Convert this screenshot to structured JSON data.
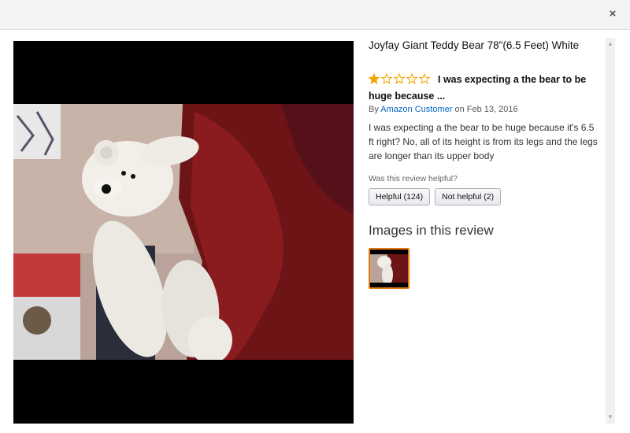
{
  "window": {
    "close_label": "×"
  },
  "product": {
    "title": "Joyfay Giant Teddy Bear 78\"(6.5 Feet) White"
  },
  "review": {
    "rating": 1,
    "rating_max": 5,
    "headline": "I was expecting a the bear to be huge because ...",
    "by_prefix": "By",
    "author": "Amazon Customer",
    "date_prefix": "on",
    "date": "Feb 13, 2016",
    "body": "I was expecting a the bear to be huge because it's 6.5 ft right? No, all of its height is from its legs and the legs are longer than its upper body",
    "helpful_question": "Was this review helpful?",
    "helpful_button": "Helpful (124)",
    "not_helpful_button": "Not helpful (2)"
  },
  "images_section": {
    "heading": "Images in this review"
  },
  "colors": {
    "star_filled": "#f0a500",
    "star_empty": "#f0a500",
    "link": "#0066c0",
    "thumb_border": "#e47911"
  }
}
